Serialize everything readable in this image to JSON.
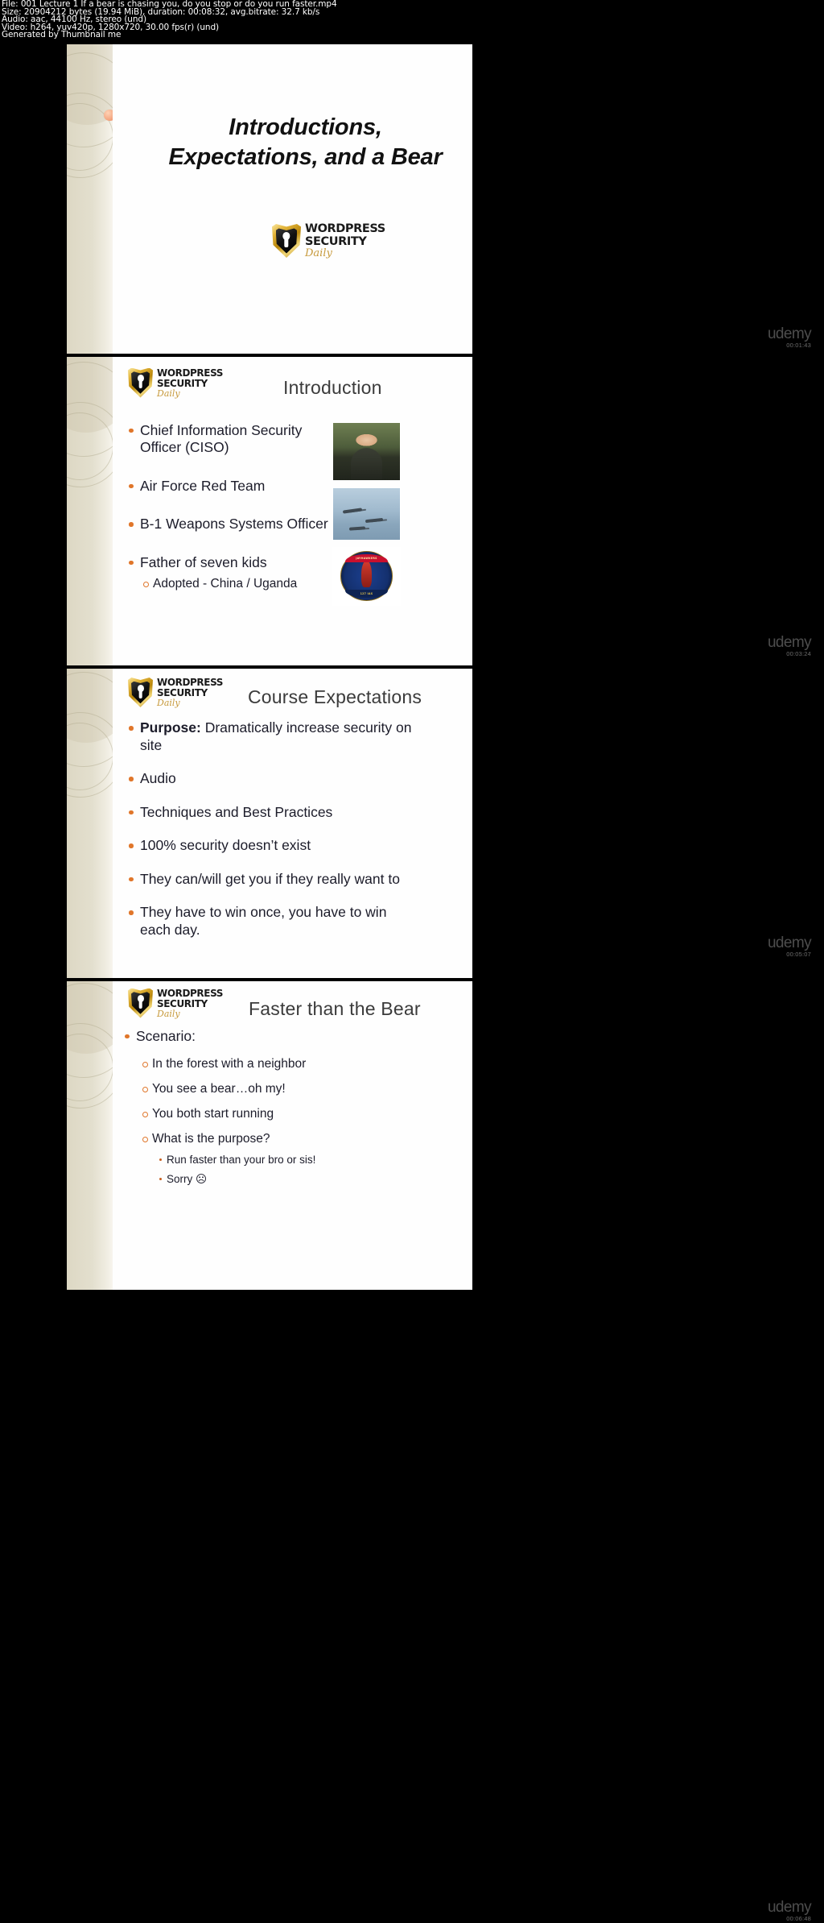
{
  "meta": {
    "line1": "File: 001 Lecture 1  If a bear is chasing you, do you stop or do you run faster.mp4",
    "line2": "Size: 20904212 bytes (19.94 MiB), duration: 00:08:32, avg.bitrate: 32.7 kb/s",
    "line3": "Audio: aac, 44100 Hz, stereo (und)",
    "line4": "Video: h264, yuv420p, 1280x720, 30.00 fps(r) (und)",
    "line5": "Generated by Thumbnail me"
  },
  "logo": {
    "line1": "WORDPRESS",
    "line2": "SECURITY",
    "line3": "Daily",
    "gold": "#c79a3c",
    "accent": "#e0762a"
  },
  "slides": [
    {
      "id": "title-slide",
      "title": "Introductions,\nExpectations, and a Bear",
      "title_line1": "Introductions,",
      "title_line2": "Expectations, and a Bear",
      "timestamp": "00:01:43"
    },
    {
      "id": "introduction-slide",
      "heading": "Introduction",
      "bullets": [
        {
          "level": 1,
          "text": "Chief Information Security Officer (CISO)"
        },
        {
          "level": 1,
          "text": "Air Force Red Team"
        },
        {
          "level": 1,
          "text": "B-1 Weapons Systems Officer"
        },
        {
          "level": 1,
          "text": "Father of seven kids"
        },
        {
          "level": 2,
          "text": "Adopted - China / Uganda"
        }
      ],
      "images": [
        {
          "name": "instructor-photo",
          "alt": "Instructor headshot"
        },
        {
          "name": "b1-bombers-photo",
          "alt": "B-1 bombers in flight"
        },
        {
          "name": "squadron-patch",
          "alt": "Jayhawkers 127 IAS squadron patch",
          "top_text": "JAYHAWKERS",
          "bottom_text": "127  IAS"
        }
      ],
      "timestamp": "00:03:24"
    },
    {
      "id": "course-expectations-slide",
      "heading": "Course Expectations",
      "bullets": [
        {
          "level": 1,
          "lead": "Purpose:",
          "text": "  Dramatically increase security on site"
        },
        {
          "level": 1,
          "text": "Audio"
        },
        {
          "level": 1,
          "text": "Techniques and Best Practices"
        },
        {
          "level": 1,
          "text": "100% security doesn’t exist"
        },
        {
          "level": 1,
          "text": "They can/will get you if they really want to"
        },
        {
          "level": 1,
          "text": "They have to win once, you have to win each day."
        }
      ],
      "timestamp": "00:05:07"
    },
    {
      "id": "faster-than-the-bear-slide",
      "heading": "Faster than the Bear",
      "bullets": [
        {
          "level": 1,
          "text": "Scenario:"
        },
        {
          "level": 2,
          "text": "In the forest with a neighbor"
        },
        {
          "level": 2,
          "text": "You see a bear…oh my!"
        },
        {
          "level": 2,
          "text": "You both start running"
        },
        {
          "level": 2,
          "text": "What is the purpose?"
        },
        {
          "level": 3,
          "text": "Run faster than your bro or sis!"
        },
        {
          "level": 3,
          "text": "Sorry ☹"
        }
      ],
      "timestamp": "00:06:48"
    }
  ],
  "watermark": {
    "brand": "udemy"
  }
}
